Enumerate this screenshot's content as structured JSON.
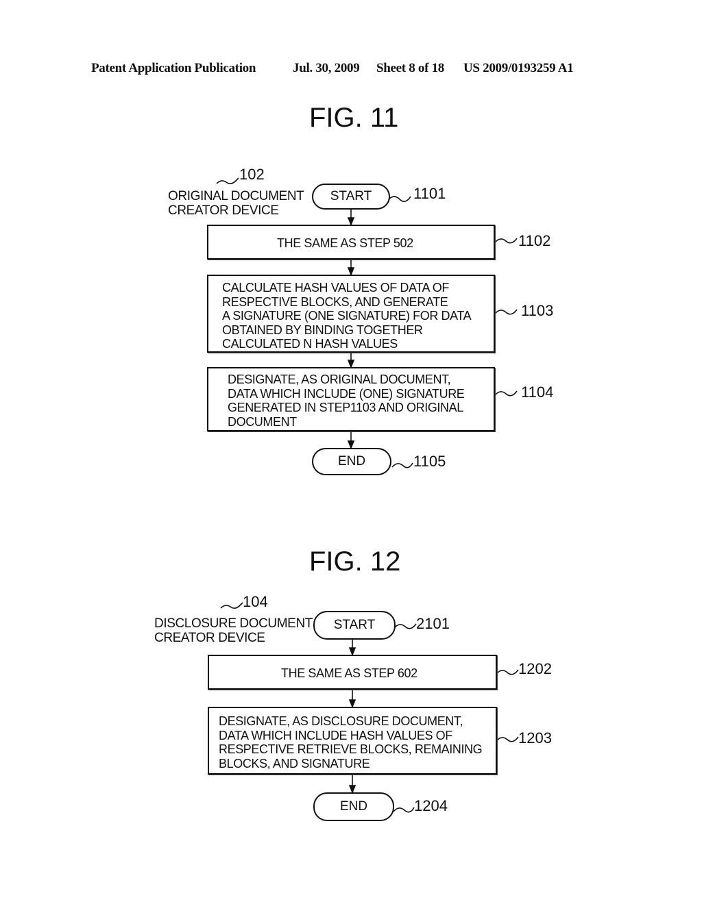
{
  "header": {
    "publication": "Patent Application Publication",
    "date": "Jul. 30, 2009",
    "sheet": "Sheet 8 of 18",
    "number": "US 2009/0193259 A1"
  },
  "fig11": {
    "title": "FIG. 11",
    "device_ref": "102",
    "device_label_line1": "ORIGINAL DOCUMENT",
    "device_label_line2": "CREATOR DEVICE",
    "start": {
      "label": "START",
      "ref": "1101"
    },
    "steps": [
      {
        "ref": "1102",
        "text": "THE SAME AS STEP 502"
      },
      {
        "ref": "1103",
        "text": "CALCULATE HASH VALUES OF DATA OF\nRESPECTIVE BLOCKS, AND GENERATE\nA SIGNATURE (ONE SIGNATURE) FOR DATA\nOBTAINED BY BINDING TOGETHER\nCALCULATED N HASH VALUES"
      },
      {
        "ref": "1104",
        "text": "DESIGNATE, AS ORIGINAL DOCUMENT,\nDATA WHICH INCLUDE (ONE) SIGNATURE\nGENERATED IN STEP1103 AND ORIGINAL\nDOCUMENT"
      }
    ],
    "end": {
      "label": "END",
      "ref": "1105"
    }
  },
  "fig12": {
    "title": "FIG. 12",
    "device_ref": "104",
    "device_label_line1": "DISCLOSURE DOCUMENT",
    "device_label_line2": "CREATOR DEVICE",
    "start": {
      "label": "START",
      "ref": "2101"
    },
    "steps": [
      {
        "ref": "1202",
        "text": "THE SAME AS STEP 602"
      },
      {
        "ref": "1203",
        "text": "DESIGNATE, AS DISCLOSURE DOCUMENT,\nDATA WHICH INCLUDE HASH VALUES OF\nRESPECTIVE RETRIEVE BLOCKS, REMAINING\nBLOCKS, AND SIGNATURE"
      }
    ],
    "end": {
      "label": "END",
      "ref": "1204"
    }
  }
}
